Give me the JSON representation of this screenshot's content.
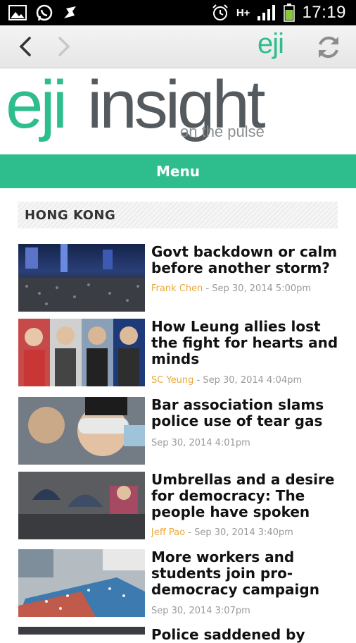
{
  "status_bar": {
    "time": "17:19",
    "network": "H+",
    "icons": [
      "image-icon",
      "whatsapp-icon",
      "bird-icon",
      "alarm-icon",
      "signal-icon",
      "battery-icon"
    ]
  },
  "toolbar": {
    "brand": "eji",
    "icons": [
      "back-icon",
      "forward-icon",
      "refresh-icon"
    ]
  },
  "logo": {
    "primary": "eji",
    "secondary": "insight",
    "tagline": "on the pulse"
  },
  "menu": {
    "label": "Menu"
  },
  "section": {
    "title": "HONG KONG"
  },
  "articles": [
    {
      "title": "Govt backdown or calm before another storm?",
      "author": "Frank Chen",
      "date": "Sep 30, 2014 5:00pm"
    },
    {
      "title": "How Leung allies lost the fight for hearts and minds",
      "author": "SC Yeung",
      "date": "Sep 30, 2014 4:04pm"
    },
    {
      "title": "Bar association slams police use of tear gas",
      "author": "",
      "date": "Sep 30, 2014 4:01pm"
    },
    {
      "title": "Umbrellas and a desire for democracy: The people have spoken",
      "author": "Jeff Pao",
      "date": "Sep 30, 2014 3:40pm"
    },
    {
      "title": "More workers and students join pro-democracy campaign",
      "author": "",
      "date": "Sep 30, 2014 3:07pm"
    },
    {
      "title": "Police saddened by",
      "author": "",
      "date": ""
    }
  ],
  "colors": {
    "accent": "#2ebd8c",
    "author": "#e8a93a",
    "logo_gray": "#555a5e"
  }
}
